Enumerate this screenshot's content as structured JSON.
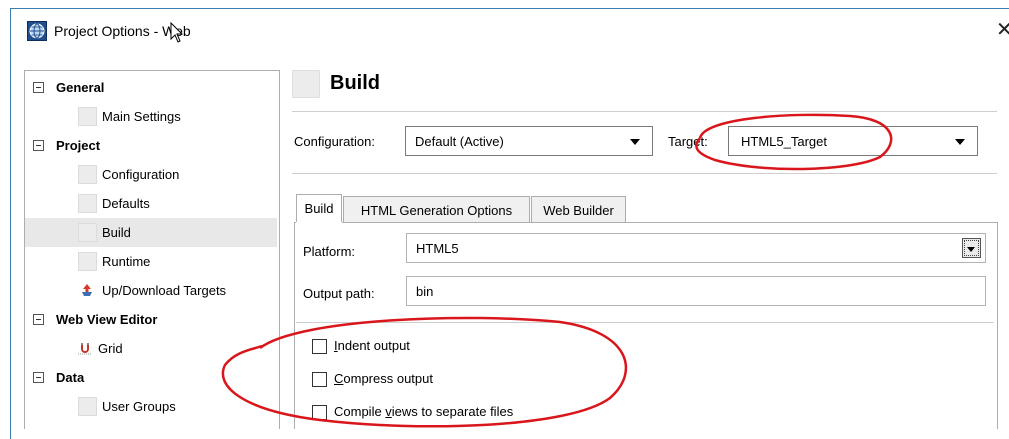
{
  "window": {
    "title": "Project Options - Web",
    "close_glyph": "✕"
  },
  "tree": {
    "items": [
      {
        "label": "General",
        "kind": "group"
      },
      {
        "label": "Main Settings",
        "kind": "leaf"
      },
      {
        "label": "Project",
        "kind": "group"
      },
      {
        "label": "Configuration",
        "kind": "leaf"
      },
      {
        "label": "Defaults",
        "kind": "leaf"
      },
      {
        "label": "Build",
        "kind": "leaf",
        "selected": true
      },
      {
        "label": "Runtime",
        "kind": "leaf"
      },
      {
        "label": "Up/Download Targets",
        "kind": "leaf",
        "icon": "upload-download-icon"
      },
      {
        "label": "Web View Editor",
        "kind": "group"
      },
      {
        "label": "Grid",
        "kind": "leaf",
        "icon": "grid-magnet-icon"
      },
      {
        "label": "Data",
        "kind": "group"
      },
      {
        "label": "User Groups",
        "kind": "leaf"
      }
    ]
  },
  "page": {
    "heading": "Build"
  },
  "configuration": {
    "label": "Configuration:",
    "value": "Default (Active)"
  },
  "target": {
    "label": "Target:",
    "value": "HTML5_Target"
  },
  "tabs": [
    {
      "label": "Build",
      "active": true
    },
    {
      "label": "HTML Generation Options",
      "active": false
    },
    {
      "label": "Web Builder",
      "active": false
    }
  ],
  "platform": {
    "label": "Platform:",
    "value": "HTML5"
  },
  "output_path": {
    "label": "Output path:",
    "value": "bin"
  },
  "checkboxes": [
    {
      "pre": "",
      "underline": "I",
      "post": "ndent output",
      "checked": false
    },
    {
      "pre": "",
      "underline": "C",
      "post": "ompress output",
      "checked": false
    },
    {
      "pre": "Compile ",
      "underline": "v",
      "post": "iews to separate files",
      "checked": false
    }
  ],
  "colors": {
    "annotation": "#d9161b",
    "window_border": "#3c7fb1",
    "selected_row": "#e8e8e8"
  }
}
